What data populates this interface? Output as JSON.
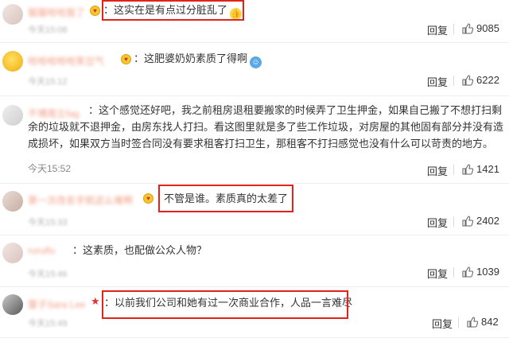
{
  "actions": {
    "reply_label": "回复"
  },
  "comments": [
    {
      "text": "：这实在是有点过分脏乱了",
      "time": "今天15:08",
      "likes": "9085",
      "username": "猫猫哈哈我了"
    },
    {
      "text": "：这肥婆奶奶素质了得啊",
      "time": "今天15:12",
      "likes": "6222",
      "username": "哈哈哈哈哈笑岔气"
    },
    {
      "text": "：这个感觉还好吧，我之前租房退租要搬家的时候弄了卫生押金，如果自己搬了不想打扫剩余的垃圾就不退押金，由房东找人打扫。看这图里就是多了些工作垃圾，对房屋的其他固有部分并没有造成损坏，如果双方当时签合同没有要求租客打扫卫生，那租客不打扫感觉也没有什么可以苛责的地方。",
      "time": "今天15:52",
      "likes": "1421",
      "username": "不博周立fag"
    },
    {
      "text": "不管是谁。素质真的太差了",
      "time": "今天15:33",
      "likes": "2402",
      "username": "第一次改名字就这么难啊"
    },
    {
      "text": "：这素质，也配做公众人物？",
      "time": "今天15:46",
      "likes": "1039",
      "username": "ruruifu"
    },
    {
      "text": "：以前我们公司和她有过一次商业合作，人品一言难尽",
      "time": "今天15:49",
      "likes": "842",
      "username": "雷子Sara Lee"
    }
  ]
}
